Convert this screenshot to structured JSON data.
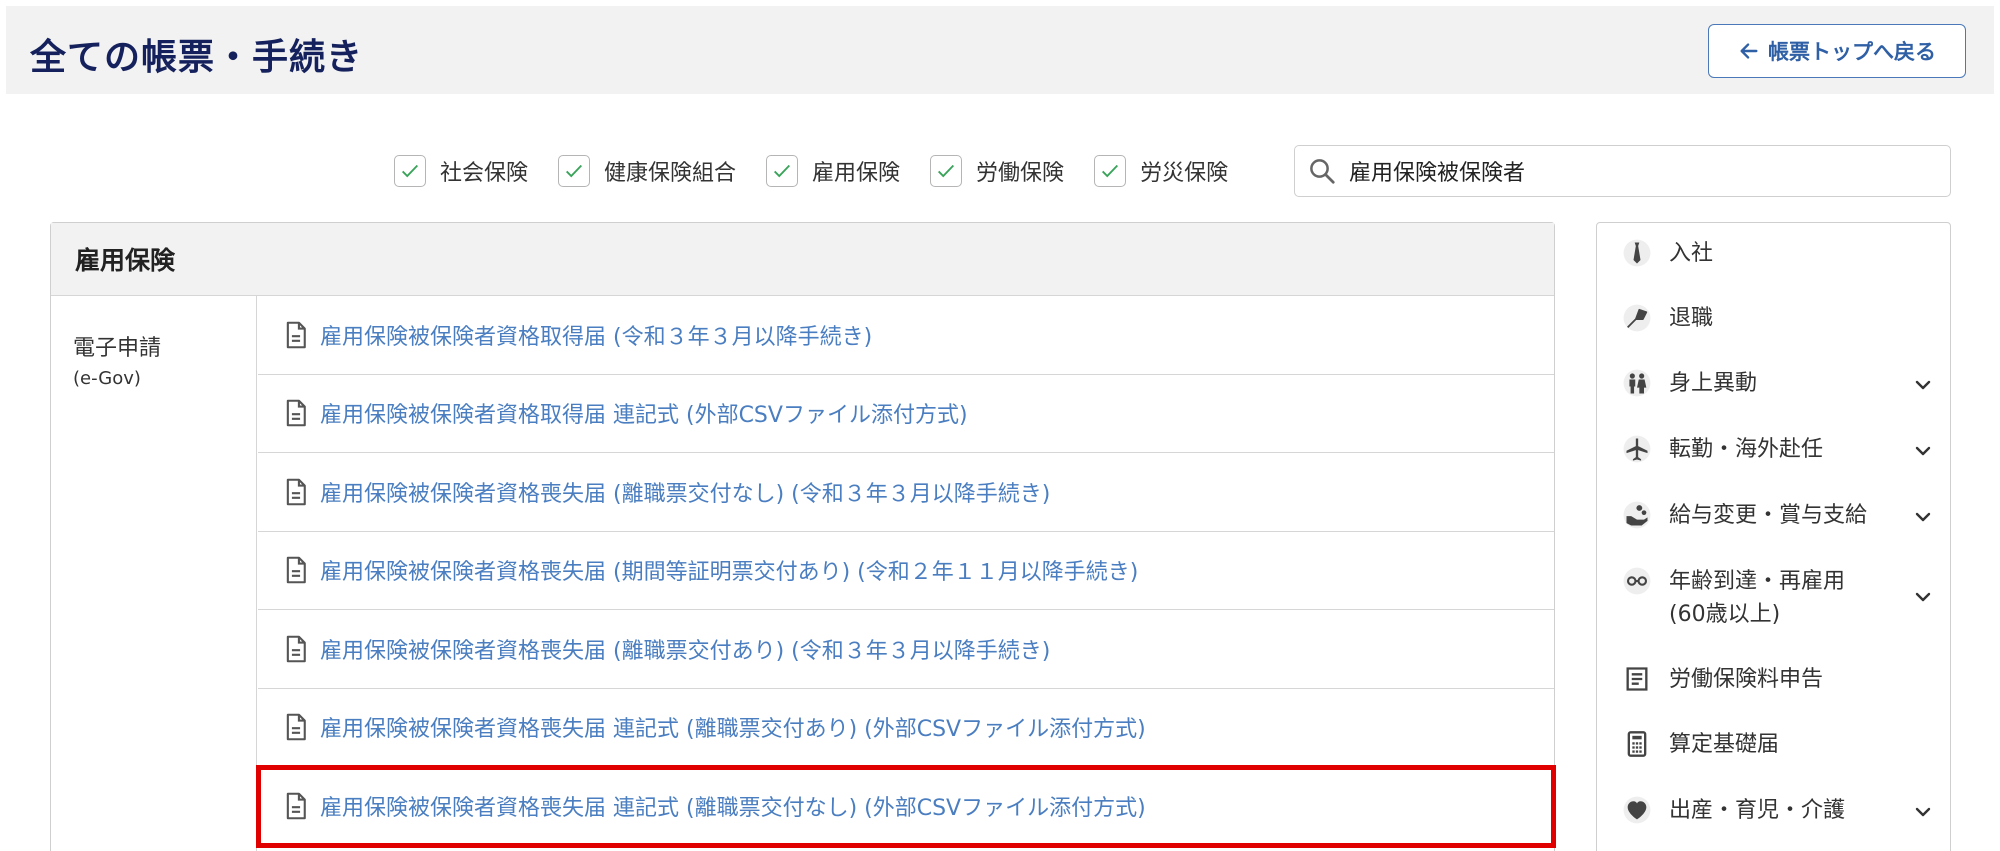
{
  "header": {
    "title": "全ての帳票・手続き",
    "back_button": "帳票トップへ戻る"
  },
  "filters": [
    {
      "label": "社会保険",
      "checked": true
    },
    {
      "label": "健康保険組合",
      "checked": true
    },
    {
      "label": "雇用保険",
      "checked": true
    },
    {
      "label": "労働保険",
      "checked": true
    },
    {
      "label": "労災保険",
      "checked": true
    }
  ],
  "search": {
    "value": "雇用保険被保険者"
  },
  "panel": {
    "title": "雇用保険",
    "category": "電子申請",
    "category_sub": "(e-Gov)",
    "forms": [
      "雇用保険被保険者資格取得届 (令和３年３月以降手続き)",
      "雇用保険被保険者資格取得届 連記式 (外部CSVファイル添付方式)",
      "雇用保険被保険者資格喪失届 (離職票交付なし) (令和３年３月以降手続き)",
      "雇用保険被保険者資格喪失届 (期間等証明票交付あり) (令和２年１１月以降手続き)",
      "雇用保険被保険者資格喪失届 (離職票交付あり) (令和３年３月以降手続き)",
      "雇用保険被保険者資格喪失届 連記式 (離職票交付あり) (外部CSVファイル添付方式)",
      "雇用保険被保険者資格喪失届 連記式 (離職票交付なし) (外部CSVファイル添付方式)"
    ]
  },
  "sidebar": {
    "items": [
      {
        "label": "入社",
        "icon": "necktie-icon",
        "expandable": false
      },
      {
        "label": "退職",
        "icon": "bouquet-icon",
        "expandable": false
      },
      {
        "label": "身上異動",
        "icon": "couple-icon",
        "expandable": true
      },
      {
        "label": "転勤・海外赴任",
        "icon": "airplane-icon",
        "expandable": true
      },
      {
        "label": "給与変更・賞与支給",
        "icon": "money-hand-icon",
        "expandable": true
      },
      {
        "label": "年齢到達・再雇用\n(60歳以上)",
        "icon": "glasses-icon",
        "expandable": true
      },
      {
        "label": "労働保険料申告",
        "icon": "document-lines-icon",
        "expandable": false
      },
      {
        "label": "算定基礎届",
        "icon": "calculator-icon",
        "expandable": false
      },
      {
        "label": "出産・育児・介護",
        "icon": "heart-icon",
        "expandable": true
      }
    ]
  },
  "colors": {
    "title": "#14215c",
    "link": "#4a7ec0",
    "accent": "#2f5fa5",
    "check": "#3aa35a",
    "highlight": "#e00000"
  }
}
